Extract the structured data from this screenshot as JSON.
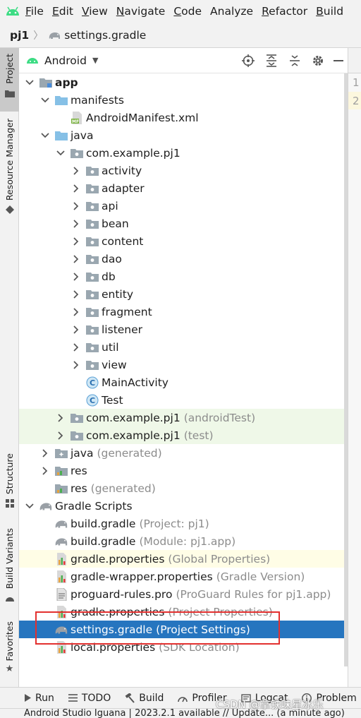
{
  "menu": {
    "items": [
      {
        "label": "File",
        "mnemonic": "F",
        "rest": "ile"
      },
      {
        "label": "Edit",
        "mnemonic": "E",
        "rest": "dit"
      },
      {
        "label": "View",
        "mnemonic": "V",
        "rest": "iew"
      },
      {
        "label": "Navigate",
        "mnemonic": "N",
        "rest": "avigate"
      },
      {
        "label": "Code",
        "mnemonic": "C",
        "rest": "ode"
      },
      {
        "label": "Analyze",
        "mnemonic": "",
        "rest": "Analyze"
      },
      {
        "label": "Refactor",
        "mnemonic": "R",
        "rest": "efactor"
      },
      {
        "label": "Build",
        "mnemonic": "B",
        "rest": "uild"
      }
    ]
  },
  "breadcrumb": {
    "root": "pj1",
    "file": "settings.gradle"
  },
  "left_stripe": {
    "project": "Project",
    "resource_manager": "Resource Manager",
    "structure": "Structure",
    "build_variants": "Build Variants",
    "favorites": "Favorites"
  },
  "panel": {
    "view_label": "Android"
  },
  "editor": {
    "line1": "1",
    "line2": "2"
  },
  "tree": [
    {
      "label": "app",
      "bold": true,
      "icon": "module-folder-icon",
      "chev": "down",
      "indent": 0
    },
    {
      "label": "manifests",
      "icon": "folder-icon",
      "chev": "down",
      "indent": 1
    },
    {
      "label": "AndroidManifest.xml",
      "icon": "manifest-file-icon",
      "chev": "",
      "indent": 2
    },
    {
      "label": "java",
      "icon": "folder-icon",
      "chev": "down",
      "indent": 1
    },
    {
      "label": "com.example.pj1",
      "icon": "package-icon",
      "chev": "down",
      "indent": 2
    },
    {
      "label": "activity",
      "icon": "package-icon",
      "chev": "right",
      "indent": 3
    },
    {
      "label": "adapter",
      "icon": "package-icon",
      "chev": "right",
      "indent": 3
    },
    {
      "label": "api",
      "icon": "package-icon",
      "chev": "right",
      "indent": 3
    },
    {
      "label": "bean",
      "icon": "package-icon",
      "chev": "right",
      "indent": 3
    },
    {
      "label": "content",
      "icon": "package-icon",
      "chev": "right",
      "indent": 3
    },
    {
      "label": "dao",
      "icon": "package-icon",
      "chev": "right",
      "indent": 3
    },
    {
      "label": "db",
      "icon": "package-icon",
      "chev": "right",
      "indent": 3
    },
    {
      "label": "entity",
      "icon": "package-icon",
      "chev": "right",
      "indent": 3
    },
    {
      "label": "fragment",
      "icon": "package-icon",
      "chev": "right",
      "indent": 3
    },
    {
      "label": "listener",
      "icon": "package-icon",
      "chev": "right",
      "indent": 3
    },
    {
      "label": "util",
      "icon": "package-icon",
      "chev": "right",
      "indent": 3
    },
    {
      "label": "view",
      "icon": "package-icon",
      "chev": "right",
      "indent": 3
    },
    {
      "label": "MainActivity",
      "icon": "class-icon",
      "chev": "",
      "indent": 3
    },
    {
      "label": "Test",
      "icon": "class-icon",
      "chev": "",
      "indent": 3
    },
    {
      "label": "com.example.pj1",
      "secondary": "(androidTest)",
      "icon": "package-icon",
      "chev": "right",
      "indent": 2,
      "style": "test"
    },
    {
      "label": "com.example.pj1",
      "secondary": "(test)",
      "icon": "package-icon",
      "chev": "right",
      "indent": 2,
      "style": "test"
    },
    {
      "label": "java",
      "secondary": "(generated)",
      "icon": "generated-folder-icon",
      "chev": "right",
      "indent": 1
    },
    {
      "label": "res",
      "icon": "res-folder-icon",
      "chev": "right",
      "indent": 1
    },
    {
      "label": "res",
      "secondary": "(generated)",
      "icon": "res-folder-icon",
      "chev": "",
      "indent": 1
    },
    {
      "label": "Gradle Scripts",
      "icon": "gradle-elephant-icon",
      "chev": "down",
      "indent": 0
    },
    {
      "label": "build.gradle",
      "secondary": "(Project: pj1)",
      "icon": "gradle-elephant-icon",
      "chev": "",
      "indent": 1
    },
    {
      "label": "build.gradle",
      "secondary": "(Module: pj1.app)",
      "icon": "gradle-elephant-icon",
      "chev": "",
      "indent": 1
    },
    {
      "label": "gradle.properties",
      "secondary": "(Global Properties)",
      "icon": "properties-file-icon",
      "chev": "",
      "indent": 1,
      "style": "hl"
    },
    {
      "label": "gradle-wrapper.properties",
      "secondary": "(Gradle Version)",
      "icon": "properties-file-icon",
      "chev": "",
      "indent": 1
    },
    {
      "label": "proguard-rules.pro",
      "secondary": "(ProGuard Rules for pj1.app)",
      "icon": "text-file-icon",
      "chev": "",
      "indent": 1
    },
    {
      "label": "gradle.properties",
      "secondary": "(Project Properties)",
      "icon": "properties-file-icon",
      "chev": "",
      "indent": 1
    },
    {
      "label": "settings.gradle",
      "secondary": "(Project Settings)",
      "icon": "gradle-elephant-icon",
      "chev": "",
      "indent": 1,
      "style": "selected"
    },
    {
      "label": "local.properties",
      "secondary": "(SDK Location)",
      "icon": "properties-file-icon",
      "chev": "",
      "indent": 1
    }
  ],
  "bottom_tabs": [
    {
      "label": "Run",
      "icon": "run-icon"
    },
    {
      "label": "TODO",
      "icon": "todo-icon"
    },
    {
      "label": "Build",
      "icon": "hammer-icon"
    },
    {
      "label": "Profiler",
      "icon": "profiler-icon"
    },
    {
      "label": "Logcat",
      "icon": "logcat-icon"
    },
    {
      "label": "Problem",
      "icon": "info-icon"
    }
  ],
  "status": {
    "text": "Android Studio Iguana | 2023.2.1 available // Update... (a minute ago)"
  },
  "watermark": {
    "text": "CSDN @拿铁味星冰乐"
  },
  "colors": {
    "selection": "#2675bf",
    "test_bg": "#eff8e8",
    "annotation": "#e3302f",
    "android_green": "#3ddc84"
  }
}
